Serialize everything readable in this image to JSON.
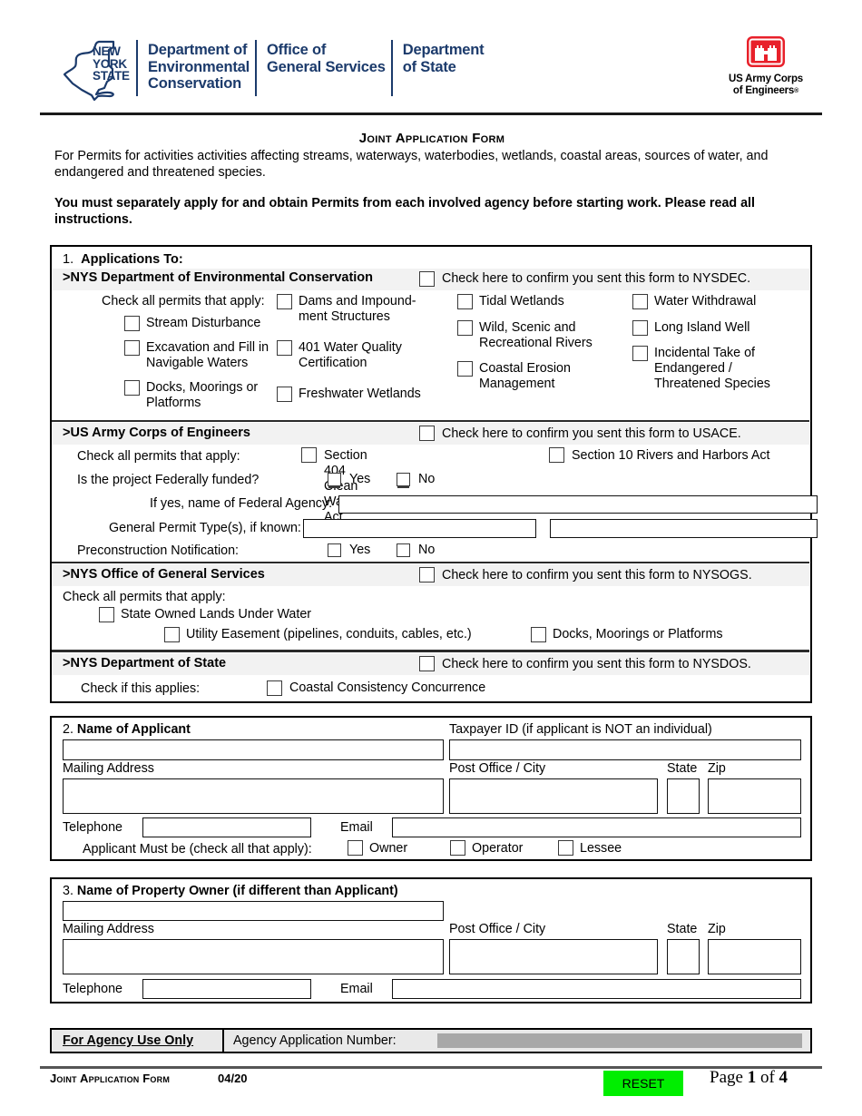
{
  "header": {
    "nys_logo_words": "NEW\nYORK\nSTATE",
    "agencies": [
      "Department of\nEnvironmental\nConservation",
      "Office of\nGeneral Services",
      "Department\nof State"
    ],
    "usace_logo_text": "US Army Corps\nof Engineers",
    "usace_reg": "®",
    "brand_color": "#1b3a6b",
    "usace_color": "#e8202a"
  },
  "title": {
    "form_title": "Joint Application Form",
    "intro": "For Permits for activities activities affecting streams, waterways, waterbodies, wetlands, coastal areas, sources of water, and endangered and threatened species.",
    "notice": "You must separately apply for and obtain Permits from each involved agency before starting work. Please read all instructions."
  },
  "section1": {
    "number": "1.",
    "heading": "Applications To:",
    "dec": {
      "title": ">NYS Department of Environmental Conservation",
      "confirm": "Check here to confirm you sent this form to NYSDEC.",
      "check_all": "Check all permits that apply:",
      "col1": [
        "Stream Disturbance",
        "Excavation and Fill in\nNavigable Waters",
        "Docks, Moorings or\nPlatforms"
      ],
      "col2": [
        "Dams and Impound-\nment Structures",
        "401 Water Quality\nCertification",
        "Freshwater Wetlands"
      ],
      "col3": [
        "Tidal Wetlands",
        "Wild, Scenic and\nRecreational Rivers",
        "Coastal Erosion\nManagement"
      ],
      "col4": [
        "Water Withdrawal",
        "Long Island Well",
        "Incidental Take of\nEndangered /\nThreatened Species"
      ]
    },
    "usace": {
      "title": ">US Army Corps of Engineers",
      "confirm": "Check here to confirm you sent this form to USACE.",
      "check_all": "Check all permits that apply:",
      "permit1": "Section 404 Clean Water Act",
      "permit2": "Section 10 Rivers and Harbors Act",
      "federally_funded_label": "Is the project Federally funded?",
      "yes": "Yes",
      "no": "No",
      "federal_agency_label": "If yes, name of Federal Agency:",
      "federal_agency_value": "",
      "general_permit_label": "General Permit Type(s), if known:",
      "general_permit_value1": "",
      "general_permit_value2": "",
      "preconstruction_label": "Preconstruction Notification:"
    },
    "ogs": {
      "title": ">NYS Office of General Services",
      "confirm": "Check here to confirm you sent this form to NYSOGS.",
      "check_all": "Check all permits that apply:",
      "item1": "State Owned Lands Under Water",
      "item2": "Utility Easement (pipelines, conduits, cables, etc.)",
      "item3": "Docks, Moorings or Platforms"
    },
    "dos": {
      "title": ">NYS Department of State",
      "confirm": "Check here to confirm you sent this form to NYSDOS.",
      "check_if": "Check if this applies:",
      "item1": "Coastal Consistency Concurrence"
    }
  },
  "section2": {
    "number": "2.",
    "heading": "Name of Applicant",
    "name_value": "",
    "taxpayer_label": "Taxpayer ID (if applicant is NOT an individual)",
    "taxpayer_value": "",
    "mailing_label": "Mailing Address",
    "mailing_value": "",
    "city_label": "Post Office / City",
    "city_value": "",
    "state_label": "State",
    "state_value": "",
    "zip_label": "Zip",
    "zip_value": "",
    "telephone_label": "Telephone",
    "telephone_value": "",
    "email_label": "Email",
    "email_value": "",
    "applicant_must_be": "Applicant Must be (check all that apply):",
    "role_owner": "Owner",
    "role_operator": "Operator",
    "role_lessee": "Lessee"
  },
  "section3": {
    "number": "3.",
    "heading": "Name of Property Owner (if different than Applicant)",
    "name_value": "",
    "mailing_label": "Mailing Address",
    "mailing_value": "",
    "city_label": "Post Office / City",
    "city_value": "",
    "state_label": "State",
    "state_value": "",
    "zip_label": "Zip",
    "zip_value": "",
    "telephone_label": "Telephone",
    "telephone_value": "",
    "email_label": "Email",
    "email_value": ""
  },
  "footer": {
    "agency_use_only": "For Agency Use Only",
    "agency_app_number_label": "Agency Application Number:",
    "agency_app_number_value": "",
    "form_name": "Joint Application Form",
    "form_date": "04/20",
    "reset_label": "RESET",
    "page_prefix": "Page",
    "page_current": "1",
    "page_of": "of",
    "page_total": "4",
    "reset_color": "#00ee00",
    "agency_field_color": "#a8a8a8"
  }
}
